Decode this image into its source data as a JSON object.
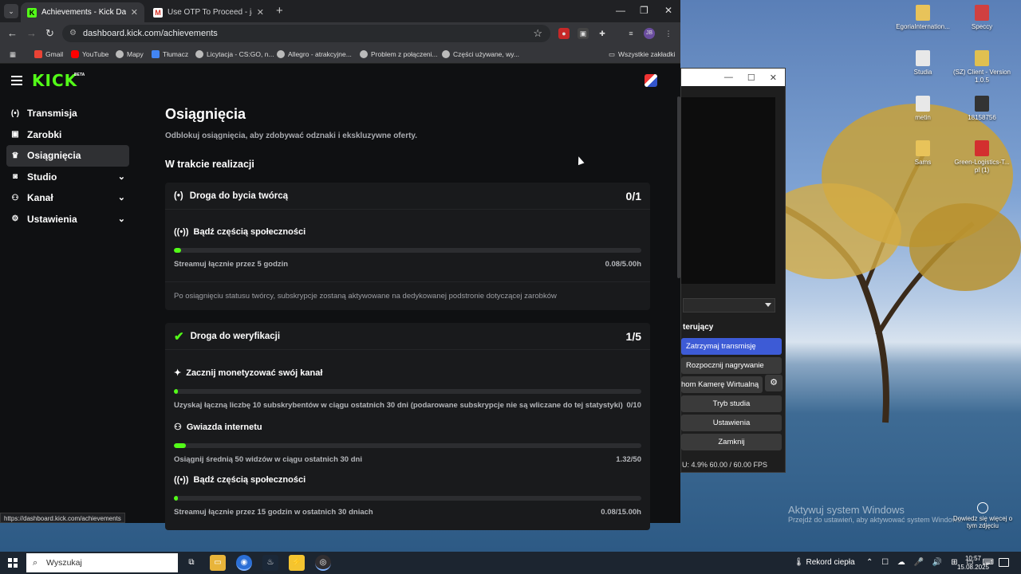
{
  "desktop": {
    "icons": [
      {
        "label": "EgoriaInternation...",
        "color": "#e8c35a"
      },
      {
        "label": "Speccy",
        "color": "#d04040"
      },
      {
        "label": "Studia",
        "color": "#e8e8e8"
      },
      {
        "label": "(SZ) Client - Version 1.0.5",
        "color": "#e0c050"
      },
      {
        "label": "metin",
        "color": "#e8e8e8"
      },
      {
        "label": "18158756",
        "color": "#333333"
      },
      {
        "label": "Sams",
        "color": "#e8c35a"
      },
      {
        "label": "Green-Logistics-T... pl (1)",
        "color": "#d32f2f"
      }
    ],
    "activate_title": "Aktywuj system Windows",
    "activate_sub": "Przejdź do ustawień, aby aktywować system Windows.",
    "learn_more": "Dowiedz się więcej o tym zdjęciu"
  },
  "obs": {
    "controls_header": "terujący",
    "buttons": [
      "Zatrzymaj transmisję",
      "Rozpocznij nagrywanie",
      "hom Kamerę Wirtualną",
      "Tryb studia",
      "Ustawienia",
      "Zamknij"
    ],
    "status": "U: 4.9%      60.00 / 60.00 FPS"
  },
  "browser": {
    "tabs": [
      {
        "title": "Achievements - Kick Dashboard",
        "active": true
      },
      {
        "title": "Use OTP To Proceed - jakubmis...",
        "active": false
      }
    ],
    "url": "dashboard.kick.com/achievements",
    "profile_initials": "JB",
    "bookmarks": [
      "Gmail",
      "YouTube",
      "Mapy",
      "Tłumacz",
      "Licytacja - CS:GO, n...",
      "Allegro - atrakcyjne...",
      "Problem z połączeni...",
      "Części używane, wy..."
    ],
    "all_bookmarks": "Wszystkie zakładki",
    "hover_url": "https://dashboard.kick.com/achievements"
  },
  "kick": {
    "logo": "KICK",
    "beta": "BETA",
    "sidebar": [
      {
        "label": "Transmisja",
        "icon": "(•)"
      },
      {
        "label": "Zarobki",
        "icon": "▣"
      },
      {
        "label": "Osiągnięcia",
        "icon": "♛",
        "active": true
      },
      {
        "label": "Studio",
        "icon": "◙",
        "chevron": true
      },
      {
        "label": "Kanał",
        "icon": "⚇",
        "chevron": true
      },
      {
        "label": "Ustawienia",
        "icon": "⚙",
        "chevron": true
      }
    ],
    "title": "Osiągnięcia",
    "subtitle": "Odblokuj osiągnięcia, aby zdobywać odznaki i ekskluzywne oferty.",
    "section_title": "W trakcie realizacji",
    "card1": {
      "title": "Droga do bycia twórcą",
      "score": "0/1",
      "task": {
        "title": "Bądź częścią społeczności",
        "desc": "Streamuj łącznie przez 5 godzin",
        "value": "0.08/5.00h",
        "progress": 0.016
      },
      "note": "Po osiągnięciu statusu twórcy, subskrypcje zostaną aktywowane na dedykowanej podstronie dotyczącej zarobków"
    },
    "card2": {
      "title": "Droga do weryfikacji",
      "score": "1/5",
      "tasks": [
        {
          "title": "Zacznij monetyzować swój kanał",
          "desc": "Uzyskaj łączną liczbę 10 subskrybentów w ciągu ostatnich 30 dni (podarowane subskrypcje nie są wliczane do tej statystyki)",
          "value": "0/10",
          "progress": 0
        },
        {
          "title": "Gwiazda internetu",
          "desc": "Osiągnij średnią 50 widzów w ciągu ostatnich 30 dni",
          "value": "1.32/50",
          "progress": 0.026
        },
        {
          "title": "Bądź częścią społeczności",
          "desc": "Streamuj łącznie przez 15 godzin w ostatnich 30 dniach",
          "value": "0.08/15.00h",
          "progress": 0.005
        }
      ]
    }
  },
  "taskbar": {
    "search_placeholder": "Wyszukaj",
    "weather": "Rekord ciepła",
    "time": "10:57",
    "date": "15.08.2025"
  }
}
